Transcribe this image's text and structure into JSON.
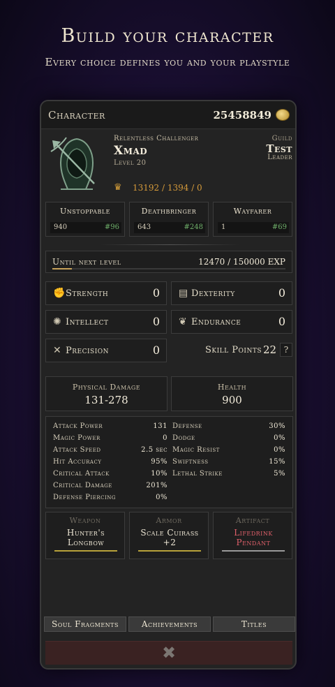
{
  "hero": {
    "title": "Build your character",
    "subtitle": "Every choice defines you and your playstyle"
  },
  "header": {
    "label": "Character",
    "gold": "25458849",
    "coin_icon": "gold-coin-icon"
  },
  "profile": {
    "title": "Relentless Challenger",
    "name": "Xmad",
    "level": "Level 20",
    "ranks_text": "13192 / 1394 / 0",
    "portrait_icon": "hooded-archer-icon",
    "guild_label": "Guild",
    "guild_name": "Test",
    "guild_role": "Leader"
  },
  "rankings": [
    {
      "title": "Unstoppable",
      "value": "940",
      "rank": "#96"
    },
    {
      "title": "Deathbringer",
      "value": "643",
      "rank": "#248"
    },
    {
      "title": "Wayfarer",
      "value": "1",
      "rank": "#69"
    }
  ],
  "experience": {
    "label": "Until next level",
    "text": "12470 / 150000 EXP",
    "progress": 0.083
  },
  "attributes": [
    {
      "name": "Strength",
      "value": "0",
      "icon": "fist-icon"
    },
    {
      "name": "Dexterity",
      "value": "0",
      "icon": "scroll-icon"
    },
    {
      "name": "Intellect",
      "value": "0",
      "icon": "brain-icon"
    },
    {
      "name": "Endurance",
      "value": "0",
      "icon": "heart-wings-icon"
    },
    {
      "name": "Precision",
      "value": "0",
      "icon": "crosshair-icon"
    }
  ],
  "skill_points": {
    "label": "Skill Points",
    "value": "22",
    "help": "?"
  },
  "big_stats": [
    {
      "label": "Physical Damage",
      "value": "131-278"
    },
    {
      "label": "Health",
      "value": "900"
    }
  ],
  "stats_left": [
    {
      "name": "Attack Power",
      "value": "131"
    },
    {
      "name": "Magic Power",
      "value": "0"
    },
    {
      "name": "Attack Speed",
      "value": "2.5 sec"
    },
    {
      "name": "Hit Accuracy",
      "value": "95%"
    },
    {
      "name": "Critical Attack",
      "value": "10%"
    },
    {
      "name": "Critical Damage",
      "value": "201%"
    },
    {
      "name": "Defense Piercing",
      "value": "0%"
    }
  ],
  "stats_right": [
    {
      "name": "Defense",
      "value": "30%"
    },
    {
      "name": "Dodge",
      "value": "0%"
    },
    {
      "name": "Magic Resist",
      "value": "0%"
    },
    {
      "name": "Swiftness",
      "value": "15%"
    },
    {
      "name": "Lethal Strike",
      "value": "5%"
    }
  ],
  "equipment": [
    {
      "slot": "Weapon",
      "name": "Hunter's Longbow",
      "color": "#efe8d6",
      "bar": "#b8a23a"
    },
    {
      "slot": "Armor",
      "name": "Scale Cuirass +2",
      "color": "#efe8d6",
      "bar": "#b8a23a"
    },
    {
      "slot": "Artifact",
      "name": "Lifedrink Pendant",
      "color": "#e0606a",
      "bar": "#9a9a9a"
    }
  ],
  "tabs": [
    "Soul Fragments",
    "Achievements",
    "Titles"
  ],
  "close": {
    "glyph": "✖",
    "icon": "close-icon"
  }
}
